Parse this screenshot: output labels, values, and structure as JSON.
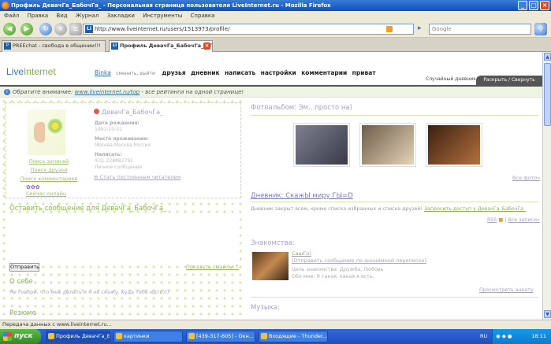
{
  "window": {
    "title": "Профиль ДевачГа_БабочГа_ - Персональная страница пользователя LiveInternet.ru - Mozilla Firefox"
  },
  "menu": [
    "Файл",
    "Правка",
    "Вид",
    "Журнал",
    "Закладки",
    "Инструменты",
    "Справка"
  ],
  "toolbar": {
    "url": "http://www.liveinternet.ru/users/1513973/profile/",
    "search_placeholder": "Google"
  },
  "tabs": [
    {
      "label": "PREEchat - свобода в общении!!!",
      "active": false
    },
    {
      "label": "Профиль ДевачГа_БабочГа_ - П...",
      "active": true
    }
  ],
  "site": {
    "logo_live": "Live",
    "logo_internet": "Internet",
    "username": "Binka",
    "change_exit": "сменить, выйти",
    "nav": [
      "друзья",
      "дневник",
      "написать",
      "настройки",
      "комментарии",
      "приват"
    ],
    "random_diary": "Случайный дневник //",
    "expand_collapse": "Раскрыть / Свернуть",
    "notice_label": "Обратите внимание:",
    "notice_link": "www.liveinternet.ru/top",
    "notice_text": "- все рейтинги на одной странице!"
  },
  "profile": {
    "name": "ДевачГа_БабочГа_",
    "links": [
      "Поиск записей",
      "Поиск друзей",
      "Поиск комментариев"
    ],
    "rating_icons": "✿✿✿",
    "online_now": "Сейчас онлайн",
    "birthdate_label": "Дата рождения:",
    "birthdate": "1991-10-01",
    "location_label": "Место проживания:",
    "location": "Москва Москва Россия",
    "write_label": "Написать:",
    "icq": "ICQ: 228882791",
    "personal_message": "Личное сообщение",
    "become_reader": "Стать постоянным читателем"
  },
  "message": {
    "title": "Оставить сообщение для ДевачГа_БабочГа_",
    "send": "Отправить",
    "show_smiles": "Показать смайлы ↑"
  },
  "about": {
    "title": "О себе",
    "text": "Не говори, что мне делать и я не скажу, куда тебе идти)))"
  },
  "resume": {
    "title": "Резюме"
  },
  "photoalbum": {
    "title": "Фотоальбом: Эм...просто на)",
    "all_photos": "Все фото»",
    "photo_colors": [
      [
        "#7d7f90",
        "#3a3a48"
      ],
      [
        "#6e5c4a",
        "#e5d4b8"
      ],
      [
        "#3a2010",
        "#b57040"
      ]
    ]
  },
  "diary": {
    "title": "Дневник: СкажЫ миру ГЫ=D",
    "text": "Дневник закрыт всем, кроме списка избранных и списка друзей!",
    "request_access": "Запросить доступ у ДевачГа_БабочГа_",
    "rss": "RSS",
    "all_posts": "Все записи»"
  },
  "dating": {
    "title": "Знакомства:",
    "name": "СашГо)",
    "send_anon": "(Отправить сообщение по анонимной переписке)",
    "goal": "Цель знакомства: Дружба, Любовь",
    "about_me": "Обо мне: Я такая, какая я есть.",
    "view_form": "Просмотреть анкету"
  },
  "music": {
    "title": "Музыка:"
  },
  "statusbar": {
    "text": "Передача данных с www.liveinternet.ru..."
  },
  "taskbar": {
    "start": "пуск",
    "tasks": [
      {
        "label": "Профиль ДевачГа_Б...",
        "active": true
      },
      {
        "label": "картинки",
        "active": false
      },
      {
        "label": "[439-317-605] - Окн...",
        "active": false
      },
      {
        "label": "Входящие - Thunder...",
        "active": false
      }
    ],
    "lang": "RU",
    "clock": "18:11"
  }
}
